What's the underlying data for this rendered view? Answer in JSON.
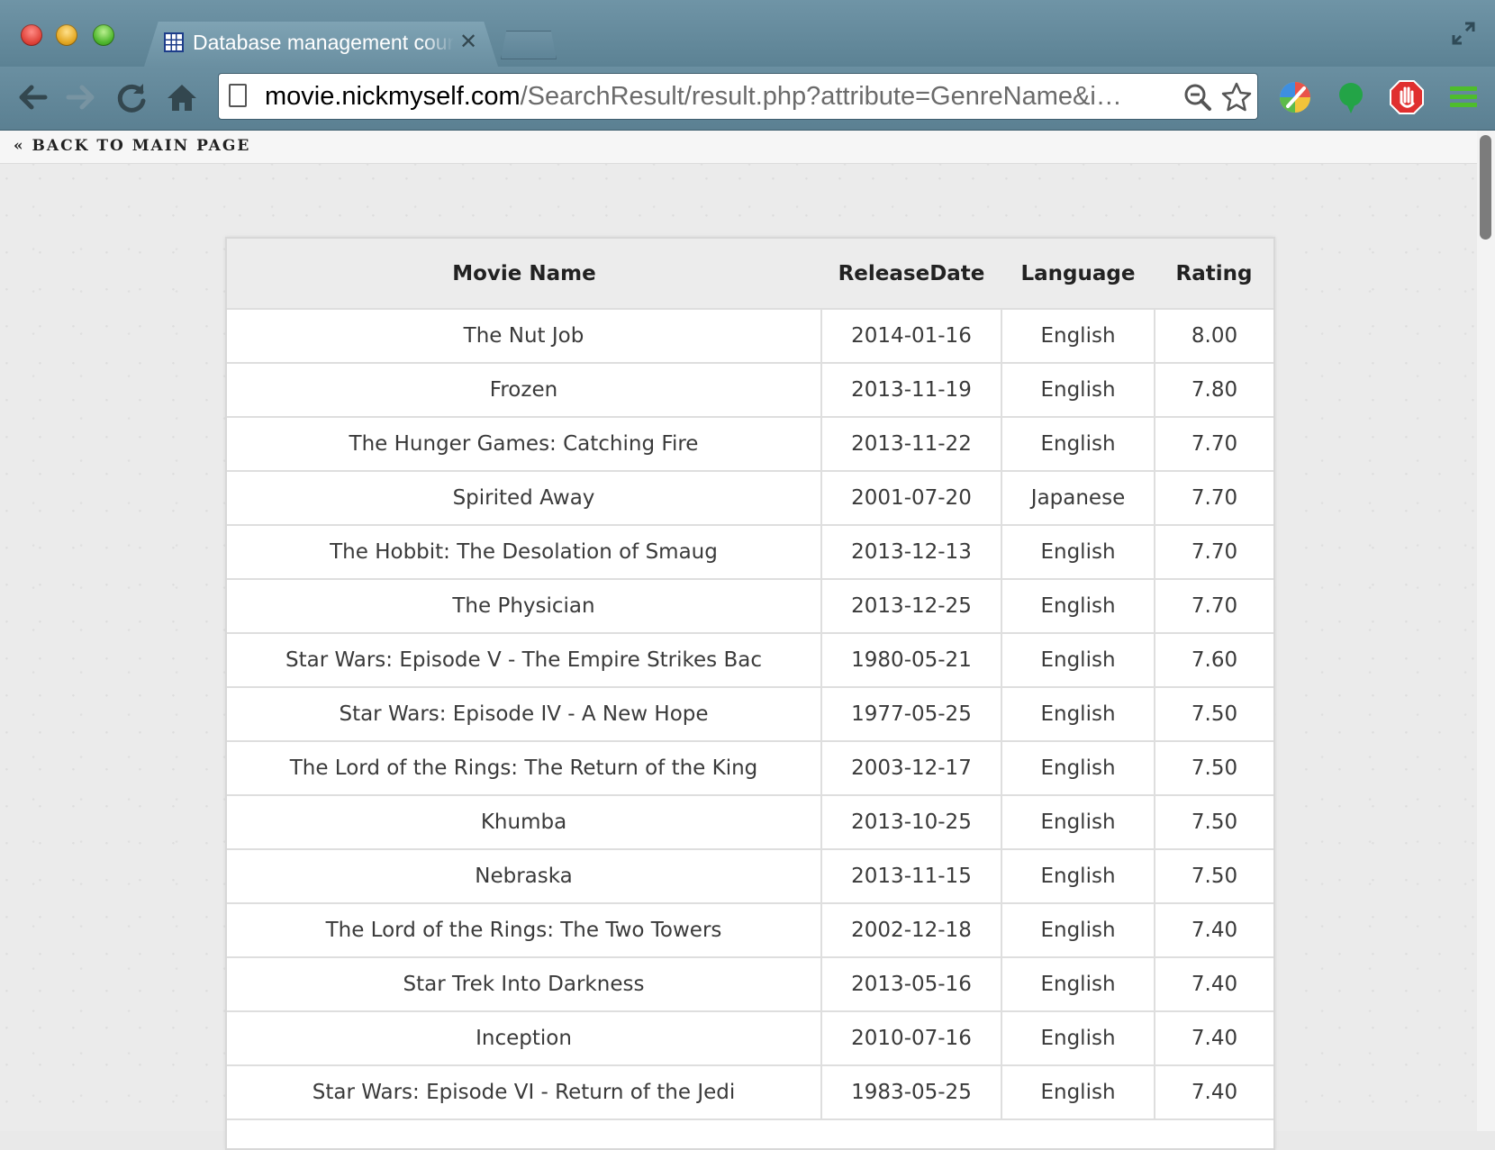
{
  "browser": {
    "tab_title": "Database management course",
    "url_host": "movie.nickmyself.com",
    "url_path": "/SearchResult/result.php?attribute=GenreName&i…"
  },
  "page": {
    "back_link": "« BACK TO MAIN PAGE"
  },
  "table": {
    "columns": [
      "Movie Name",
      "ReleaseDate",
      "Language",
      "Rating"
    ],
    "rows": [
      {
        "name": "The Nut Job",
        "date": "2014-01-16",
        "language": "English",
        "rating": "8.00"
      },
      {
        "name": "Frozen",
        "date": "2013-11-19",
        "language": "English",
        "rating": "7.80"
      },
      {
        "name": "The Hunger Games: Catching Fire",
        "date": "2013-11-22",
        "language": "English",
        "rating": "7.70"
      },
      {
        "name": "Spirited Away",
        "date": "2001-07-20",
        "language": "Japanese",
        "rating": "7.70"
      },
      {
        "name": "The Hobbit: The Desolation of Smaug",
        "date": "2013-12-13",
        "language": "English",
        "rating": "7.70"
      },
      {
        "name": "The Physician",
        "date": "2013-12-25",
        "language": "English",
        "rating": "7.70"
      },
      {
        "name": "Star Wars: Episode V - The Empire Strikes Bac",
        "date": "1980-05-21",
        "language": "English",
        "rating": "7.60"
      },
      {
        "name": "Star Wars: Episode IV - A New Hope",
        "date": "1977-05-25",
        "language": "English",
        "rating": "7.50"
      },
      {
        "name": "The Lord of the Rings: The Return of the King",
        "date": "2003-12-17",
        "language": "English",
        "rating": "7.50"
      },
      {
        "name": "Khumba",
        "date": "2013-10-25",
        "language": "English",
        "rating": "7.50"
      },
      {
        "name": "Nebraska",
        "date": "2013-11-15",
        "language": "English",
        "rating": "7.50"
      },
      {
        "name": "The Lord of the Rings: The Two Towers",
        "date": "2002-12-18",
        "language": "English",
        "rating": "7.40"
      },
      {
        "name": "Star Trek Into Darkness",
        "date": "2013-05-16",
        "language": "English",
        "rating": "7.40"
      },
      {
        "name": "Inception",
        "date": "2010-07-16",
        "language": "English",
        "rating": "7.40"
      },
      {
        "name": "Star Wars: Episode VI - Return of the Jedi",
        "date": "1983-05-25",
        "language": "English",
        "rating": "7.40"
      }
    ]
  }
}
